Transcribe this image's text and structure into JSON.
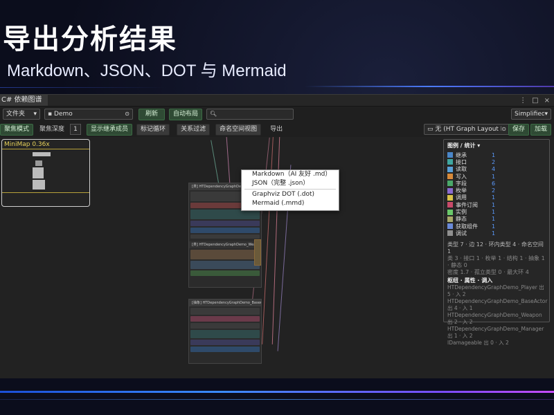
{
  "slide": {
    "title": "导出分析结果",
    "subtitle": "Markdown、JSON、DOT 与 Mermaid"
  },
  "window": {
    "tab_label": "C# 依赖图谱",
    "tab_controls": [
      "⋮",
      "□",
      "×"
    ]
  },
  "toolbar1": {
    "folder_select": "文件夹",
    "path_value": "Demo",
    "refresh": "刷新",
    "auto_layout": "自动布局",
    "search_placeholder": "",
    "mode_select": "Simplified C"
  },
  "toolbar2": {
    "cluster_mode": "聚焦模式",
    "cluster_depth_label": "聚焦深度",
    "cluster_depth_value": "1",
    "show_inherited": "显示继承成员",
    "mark_cycles": "标记循环",
    "relation_filter": "关系过滤",
    "namespace_view": "命名空间视图",
    "export_partial": "导出",
    "preset_select": "无 (HT Graph Layout Pre",
    "save": "保存",
    "load": "加载"
  },
  "export_menu": {
    "items": [
      "Markdown（AI 友好 .md）",
      "JSON（完整 .json）",
      "Graphviz DOT (.dot)",
      "Mermaid (.mmd)"
    ]
  },
  "minimap": {
    "label": "MiniMap  0.36x"
  },
  "nodes": [
    {
      "title": "[类] HTDependencyGraphDemo_Player"
    },
    {
      "title": "[类] HTDependencyGraphDemo_Weapon"
    },
    {
      "title": "[抽象] HTDependencyGraphDemo_BaseActor"
    }
  ],
  "legend": {
    "title": "图例 / 统计 ▾",
    "items": [
      {
        "name": "继承",
        "count": "1",
        "color": "#4a86c8"
      },
      {
        "name": "接口",
        "count": "2",
        "color": "#3fa7a0"
      },
      {
        "name": "读取",
        "count": "4",
        "color": "#5aa0d8"
      },
      {
        "name": "写入",
        "count": "1",
        "color": "#d88a3a"
      },
      {
        "name": "字段",
        "count": "6",
        "color": "#4aa86a"
      },
      {
        "name": "枚举",
        "count": "2",
        "color": "#8a6ad0"
      },
      {
        "name": "调用",
        "count": "1",
        "color": "#d8c24a"
      },
      {
        "name": "事件订阅",
        "count": "1",
        "color": "#c84a6a"
      },
      {
        "name": "实例",
        "count": "1",
        "color": "#6ac86a"
      },
      {
        "name": "静态",
        "count": "1",
        "color": "#a8a86a"
      },
      {
        "name": "获取组件",
        "count": "1",
        "color": "#6a8ad8"
      },
      {
        "name": "调试",
        "count": "1",
        "color": "#909090"
      }
    ],
    "stats_line1": "类型 7 · 边 12 · 环内类型 4 · 命名空间 1",
    "stats_line2": "类 3 · 接口 1 · 枚举 1 · 结构 1 · 抽象 1 · 静态 0",
    "stats_line3": "密度 1.7 · 孤立类型 0 · 最大环 4",
    "ranking_title": "枢纽 · 属性 · 调入",
    "ranking": [
      "HTDependencyGraphDemo_Player  出 5 · 入 2",
      "HTDependencyGraphDemo_BaseActor  出 4 · 入 1",
      "HTDependencyGraphDemo_Weapon  出 2 · 入 2",
      "HTDependencyGraphDemo_Manager  出 1 · 入 2",
      "IDamageable  出 0 · 入 2"
    ]
  }
}
